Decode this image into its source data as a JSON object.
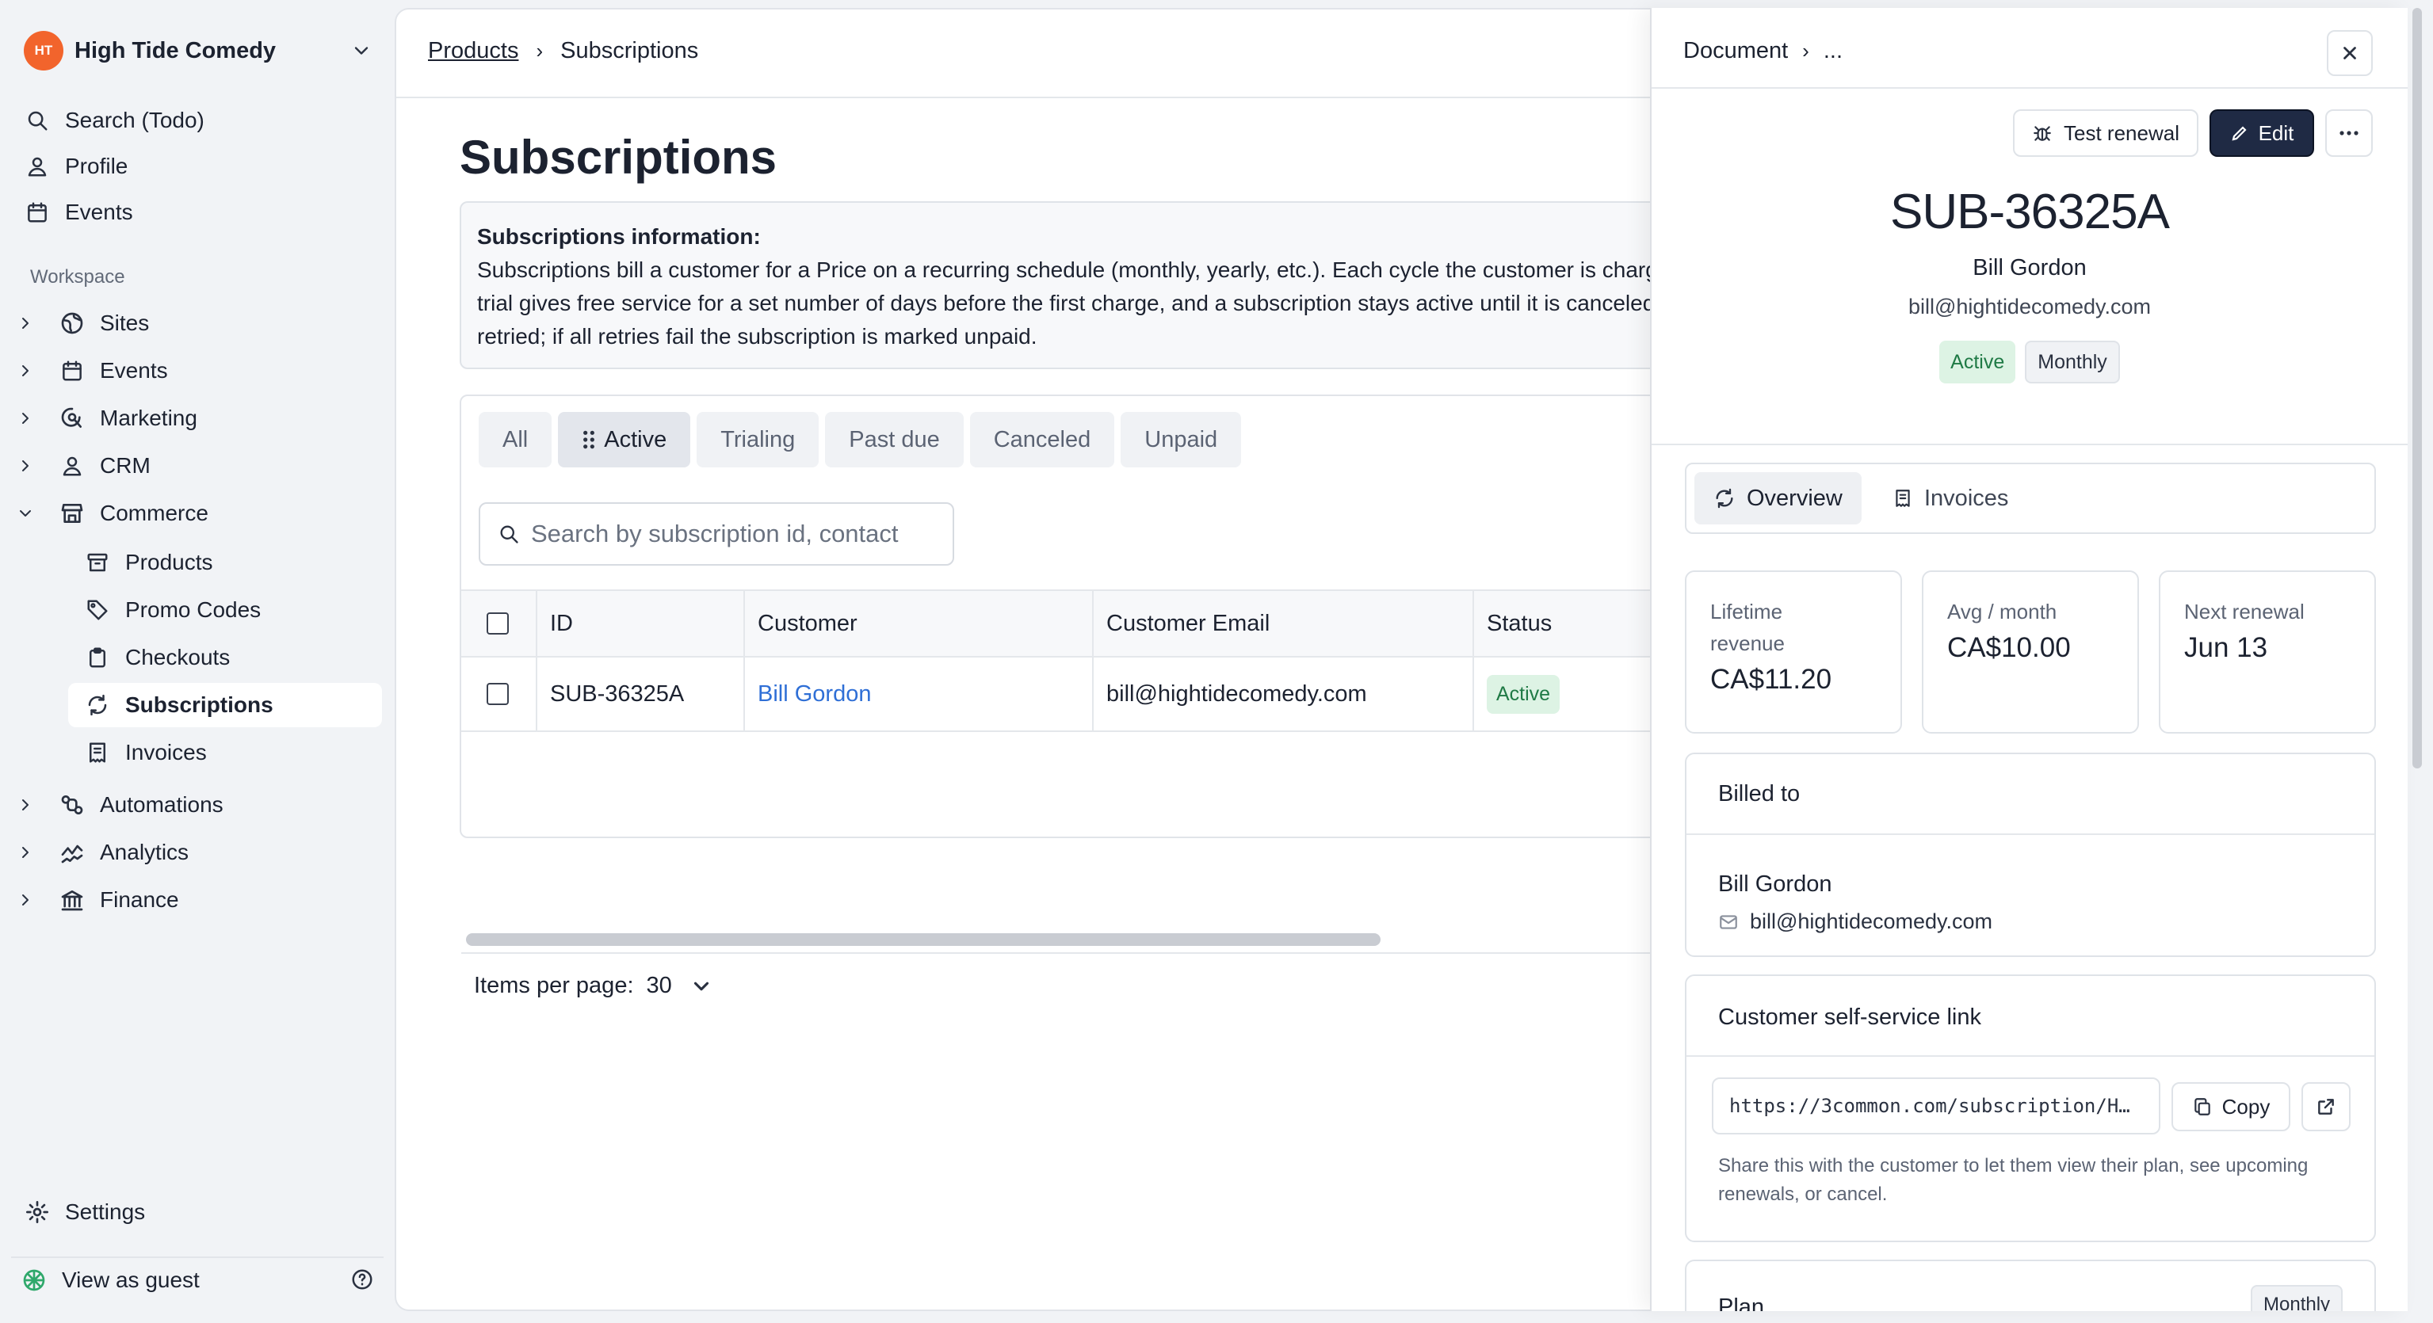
{
  "sidebar": {
    "org_initials": "HT",
    "org_name": "High Tide Comedy",
    "top_items": [
      {
        "label": "Search (Todo)",
        "icon": "search-icon"
      },
      {
        "label": "Profile",
        "icon": "user-icon"
      },
      {
        "label": "Events",
        "icon": "calendar-icon"
      }
    ],
    "section_label": "Workspace",
    "workspace_items": [
      {
        "label": "Sites",
        "icon": "globe-icon"
      },
      {
        "label": "Events",
        "icon": "calendar-icon"
      },
      {
        "label": "Marketing",
        "icon": "marketing-icon"
      },
      {
        "label": "CRM",
        "icon": "user-icon"
      },
      {
        "label": "Commerce",
        "icon": "store-icon"
      }
    ],
    "commerce_items": [
      {
        "label": "Products",
        "icon": "archive-icon"
      },
      {
        "label": "Promo Codes",
        "icon": "tag-icon"
      },
      {
        "label": "Checkouts",
        "icon": "clipboard-icon"
      },
      {
        "label": "Subscriptions",
        "icon": "refresh-icon"
      },
      {
        "label": "Invoices",
        "icon": "receipt-icon"
      }
    ],
    "more_items": [
      {
        "label": "Automations",
        "icon": "automation-icon"
      },
      {
        "label": "Analytics",
        "icon": "analytics-icon"
      },
      {
        "label": "Finance",
        "icon": "bank-icon"
      }
    ],
    "settings_label": "Settings",
    "guest_label": "View as guest"
  },
  "main": {
    "breadcrumb": {
      "parent": "Products",
      "current": "Subscriptions"
    },
    "title": "Subscriptions",
    "info": {
      "heading": "Subscriptions information:",
      "body": "Subscriptions bill a customer for a Price on a recurring schedule (monthly, yearly, etc.). Each cycle the customer is charged automatically. A trial gives free service for a set number of days before the first charge, and a subscription stays active until it is canceled. Failed payments are retried; if all retries fail the subscription is marked unpaid."
    },
    "tabs": [
      "All",
      "Active",
      "Trialing",
      "Past due",
      "Canceled",
      "Unpaid"
    ],
    "search_placeholder": "Search by subscription id, contact",
    "table": {
      "headers": [
        "ID",
        "Customer",
        "Customer Email",
        "Status"
      ],
      "rows": [
        {
          "id": "SUB-36325A",
          "customer": "Bill Gordon",
          "email": "bill@hightidecomedy.com",
          "status": "Active"
        }
      ]
    },
    "pagination": {
      "label": "Items per page:",
      "value": "30"
    }
  },
  "drawer": {
    "breadcrumb": {
      "root": "Document",
      "rest": "..."
    },
    "actions": {
      "test_renewal": "Test renewal",
      "edit": "Edit"
    },
    "sub_id": "SUB-36325A",
    "customer_name": "Bill Gordon",
    "customer_email": "bill@hightidecomedy.com",
    "badges": {
      "status": "Active",
      "interval": "Monthly"
    },
    "tabs": {
      "overview": "Overview",
      "invoices": "Invoices"
    },
    "stats": [
      {
        "label": "Lifetime revenue",
        "value": "CA$11.20"
      },
      {
        "label": "Avg / month",
        "value": "CA$10.00"
      },
      {
        "label": "Next renewal",
        "value": "Jun 13"
      }
    ],
    "billed_to": {
      "title": "Billed to",
      "name": "Bill Gordon",
      "email": "bill@hightidecomedy.com"
    },
    "self_service": {
      "title": "Customer self-service link",
      "url": "https://3common.com/subscription/H…",
      "copy_label": "Copy",
      "description": "Share this with the customer to let them view their plan, see upcoming renewals, or cancel."
    },
    "plan": {
      "title": "Plan",
      "badge": "Monthly"
    }
  },
  "colors": {
    "accent": "#1f2a44",
    "brand": "#f2642c",
    "link": "#2f6fd6",
    "success_bg": "#ddf3e4",
    "success_text": "#1f7a45"
  }
}
